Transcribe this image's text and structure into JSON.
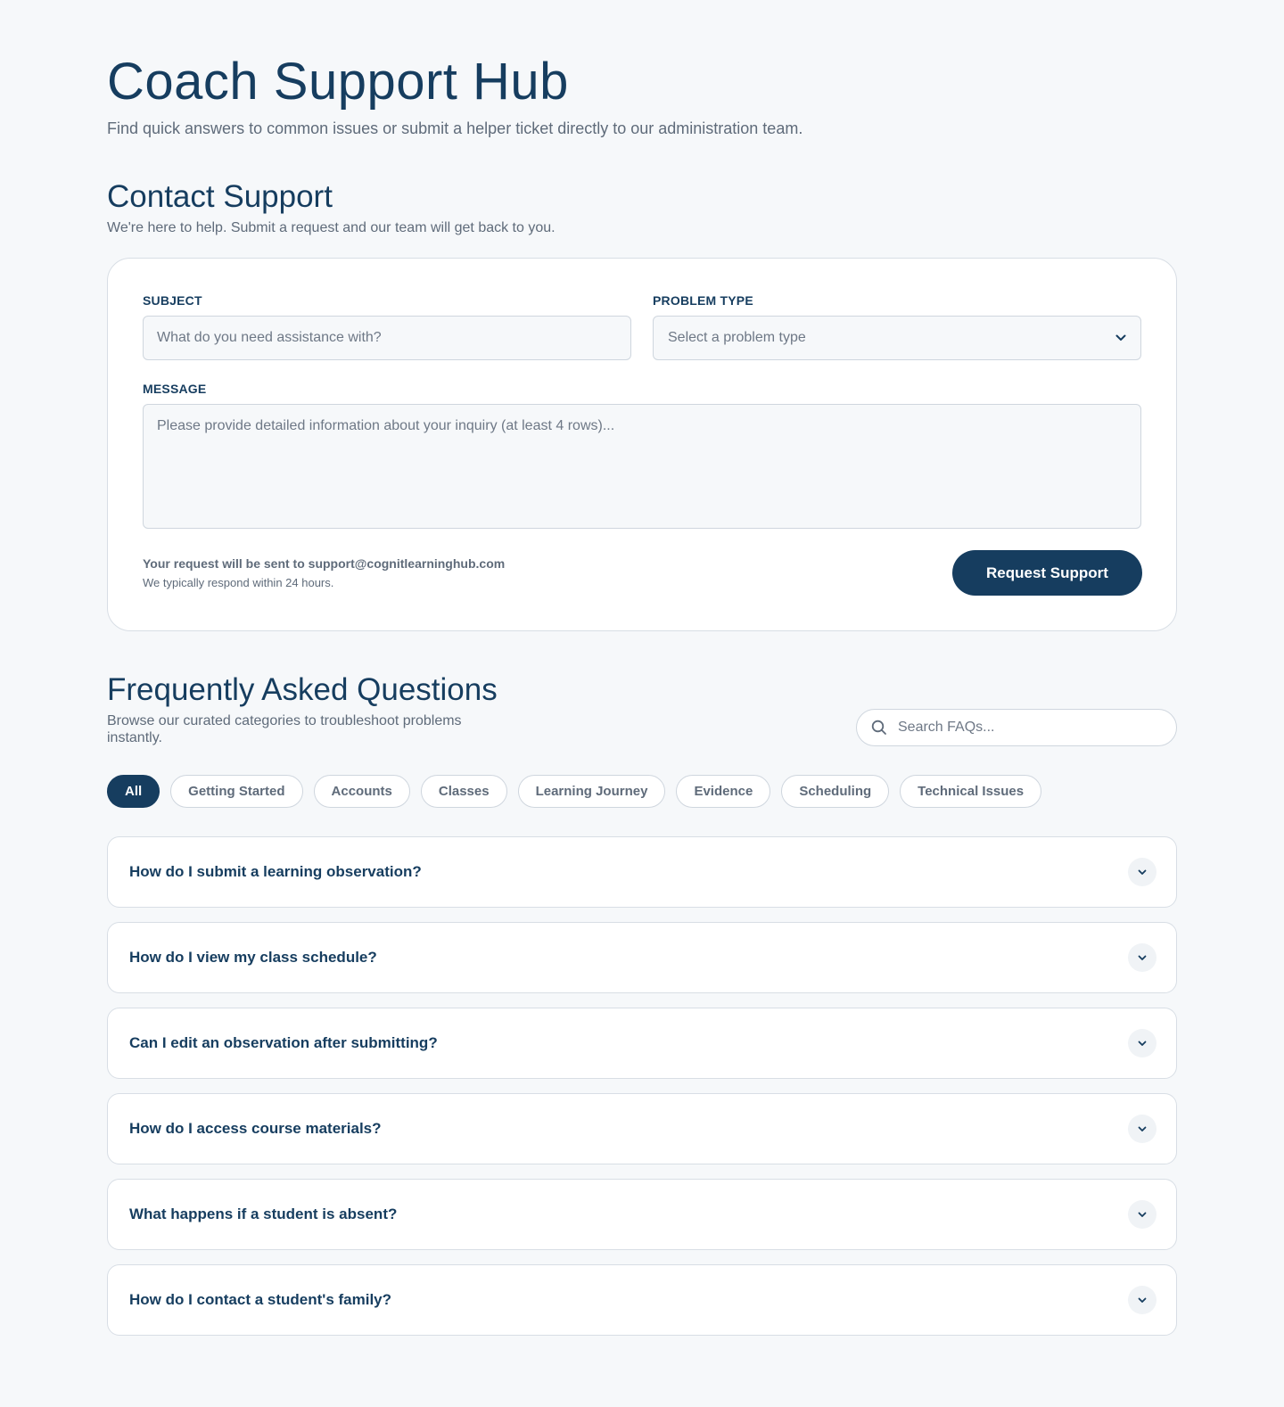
{
  "header": {
    "title": "Coach Support Hub",
    "subtitle": "Find quick answers to common issues or submit a helper ticket directly to our administration team."
  },
  "contact": {
    "title": "Contact Support",
    "subtitle": "We're here to help. Submit a request and our team will get back to you.",
    "subject_label": "SUBJECT",
    "subject_placeholder": "What do you need assistance with?",
    "subject_value": "",
    "problem_type_label": "PROBLEM TYPE",
    "problem_type_selected": "Select a problem type",
    "message_label": "MESSAGE",
    "message_placeholder": "Please provide detailed information about your inquiry (at least 4 rows)...",
    "message_value": "",
    "send_info": "Your request will be sent to support@cognitlearninghub.com",
    "response_time": "We typically respond within 24 hours.",
    "submit_label": "Request Support"
  },
  "faq": {
    "title": "Frequently Asked Questions",
    "subtitle_line1": "Browse our curated categories to troubleshoot problems",
    "subtitle_line2": "instantly.",
    "search_placeholder": "Search FAQs...",
    "categories": [
      {
        "label": "All",
        "active": true
      },
      {
        "label": "Getting Started",
        "active": false
      },
      {
        "label": "Accounts",
        "active": false
      },
      {
        "label": "Classes",
        "active": false
      },
      {
        "label": "Learning Journey",
        "active": false
      },
      {
        "label": "Evidence",
        "active": false
      },
      {
        "label": "Scheduling",
        "active": false
      },
      {
        "label": "Technical Issues",
        "active": false
      }
    ],
    "questions": [
      "How do I submit a learning observation?",
      "How do I view my class schedule?",
      "Can I edit an observation after submitting?",
      "How do I access course materials?",
      "What happens if a student is absent?",
      "How do I contact a student's family?"
    ]
  },
  "icons": {
    "search": "search-icon",
    "chevron": "chevron-down-icon"
  },
  "colors": {
    "primary": "#163d5f",
    "background": "#f6f8fa",
    "muted_text": "#5f6b7a",
    "border": "#d8dee5"
  }
}
